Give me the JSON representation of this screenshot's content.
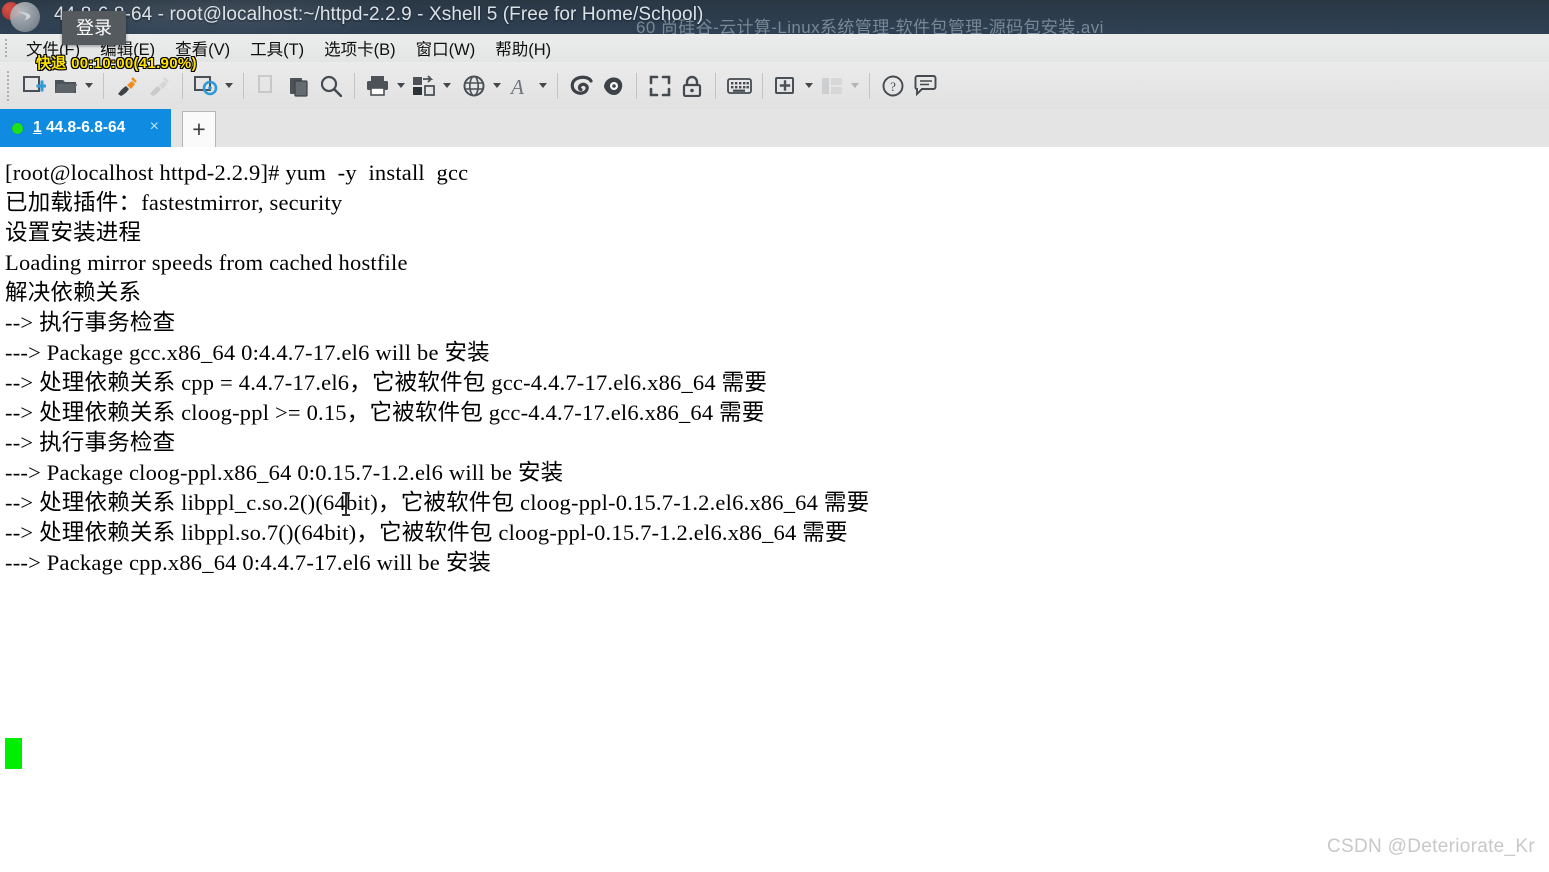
{
  "window": {
    "title": "44.8-6.8-64 - root@localhost:~/httpd-2.2.9 - Xshell 5 (Free for Home/School)",
    "logo_icon": "xshell-logo-icon"
  },
  "overlays": {
    "login_tooltip": "登录",
    "player_osd": "快退 00:10:00(41.90%)",
    "video_title": "60 尚硅谷-云计算-Linux系统管理-软件包管理-源码包安装.avi"
  },
  "menubar": {
    "items": [
      {
        "label": "文件(F)",
        "name": "menu-file"
      },
      {
        "label": "编辑(E)",
        "name": "menu-edit"
      },
      {
        "label": "查看(V)",
        "name": "menu-view"
      },
      {
        "label": "工具(T)",
        "name": "menu-tools"
      },
      {
        "label": "选项卡(B)",
        "name": "menu-tabs"
      },
      {
        "label": "窗口(W)",
        "name": "menu-window"
      },
      {
        "label": "帮助(H)",
        "name": "menu-help"
      }
    ]
  },
  "toolbar": {
    "buttons": [
      {
        "name": "new-session-icon",
        "label": "新建"
      },
      {
        "name": "open-folder-icon",
        "label": "打开"
      },
      {
        "name": "connect-icon",
        "label": "连接"
      },
      {
        "name": "disconnect-icon",
        "label": "断开"
      },
      {
        "name": "session-properties-icon",
        "label": "属性"
      },
      {
        "name": "copy-icon",
        "label": "复制"
      },
      {
        "name": "paste-icon",
        "label": "粘贴"
      },
      {
        "name": "find-icon",
        "label": "查找"
      },
      {
        "name": "print-icon",
        "label": "打印"
      },
      {
        "name": "transfer-file-icon",
        "label": "传输文件"
      },
      {
        "name": "globe-icon",
        "label": "编码"
      },
      {
        "name": "font-icon",
        "label": "字体"
      },
      {
        "name": "log-icon",
        "label": "日志"
      },
      {
        "name": "highlight-icon",
        "label": "高亮"
      },
      {
        "name": "fullscreen-icon",
        "label": "全屏"
      },
      {
        "name": "lock-icon",
        "label": "锁定"
      },
      {
        "name": "keyboard-icon",
        "label": "键盘"
      },
      {
        "name": "add-to-folder-icon",
        "label": "添加"
      },
      {
        "name": "layout-icon",
        "label": "布局"
      },
      {
        "name": "help-icon",
        "label": "帮助"
      },
      {
        "name": "feedback-icon",
        "label": "反馈"
      }
    ]
  },
  "tabs": {
    "active": {
      "index": "1",
      "label": "44.8-6.8-64",
      "status": "connected",
      "close_label": "×"
    },
    "new_tab_label": "+"
  },
  "terminal": {
    "lines": [
      "[root@localhost httpd-2.2.9]# yum  -y  install  gcc",
      "已加载插件：fastestmirror, security",
      "设置安装进程",
      "Loading mirror speeds from cached hostfile",
      "解决依赖关系",
      "--> 执行事务检查",
      "---> Package gcc.x86_64 0:4.4.7-17.el6 will be 安装",
      "--> 处理依赖关系 cpp = 4.4.7-17.el6，它被软件包 gcc-4.4.7-17.el6.x86_64 需要",
      "--> 处理依赖关系 cloog-ppl >= 0.15，它被软件包 gcc-4.4.7-17.el6.x86_64 需要",
      "--> 执行事务检查",
      "---> Package cloog-ppl.x86_64 0:0.15.7-1.2.el6 will be 安装",
      "--> 处理依赖关系 libppl_c.so.2()(64bit)，它被软件包 cloog-ppl-0.15.7-1.2.el6.x86_64 需要",
      "--> 处理依赖关系 libppl.so.7()(64bit)，它被软件包 cloog-ppl-0.15.7-1.2.el6.x86_64 需要",
      "---> Package cpp.x86_64 0:4.4.7-17.el6 will be 安装"
    ],
    "cursor": "block"
  },
  "watermark": "CSDN @Deteriorate_Kr",
  "colors": {
    "tab_active": "#0f8ce2",
    "cursor_green": "#00ee00",
    "status_dot": "#1ee01e",
    "osd_yellow": "#ffe400",
    "terminal_bg": "#ffffff",
    "terminal_fg": "#000000"
  }
}
